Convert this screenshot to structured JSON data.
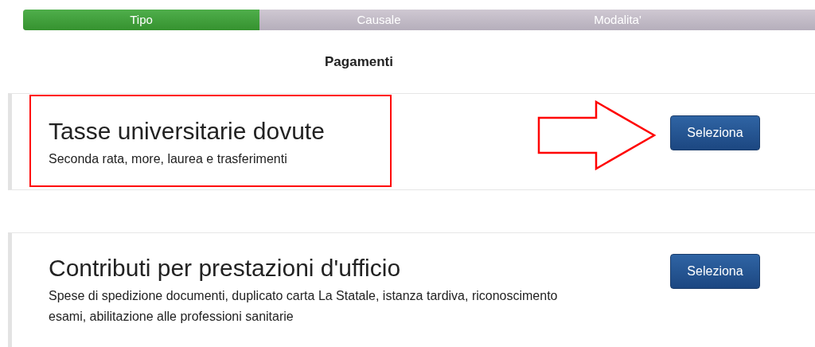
{
  "steps": [
    {
      "label": "Tipo",
      "selected": true
    },
    {
      "label": "Causale",
      "selected": false
    },
    {
      "label": "Modalita'",
      "selected": false
    }
  ],
  "heading": "Pagamenti",
  "cards": [
    {
      "title": "Tasse universitarie dovute",
      "description": "Seconda rata, more, laurea e trasferimenti",
      "button": "Seleziona"
    },
    {
      "title": "Contributi per prestazioni d'ufficio",
      "description": "Spese di spedizione documenti, duplicato carta La Statale, istanza tardiva, riconoscimento esami, abilitazione alle professioni sanitarie",
      "button": "Seleziona"
    }
  ]
}
